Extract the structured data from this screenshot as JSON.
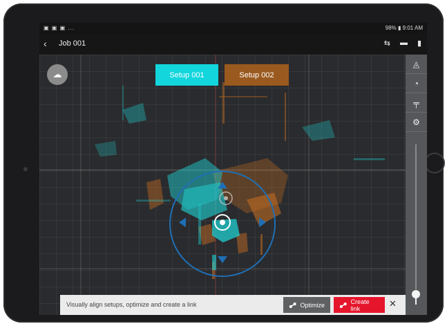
{
  "status_bar": {
    "left_icons": "▣ ▣ ▣ ...",
    "right_text": "98% ▮ 9:01 AM"
  },
  "app_bar": {
    "back_icon": "‹",
    "title": "Job 001",
    "icons": [
      "⇆",
      "▬",
      "▮"
    ]
  },
  "viewport": {
    "layer_icon": "☁",
    "setups": [
      {
        "label": "Setup 001",
        "color": "#12d6dc"
      },
      {
        "label": "Setup 002",
        "color": "#9a5a1f"
      }
    ]
  },
  "sidebar": {
    "buttons": [
      "◬",
      "◔",
      "╤",
      "⚙"
    ]
  },
  "bottom_bar": {
    "hint": "Visually align setups, optimize and create a link",
    "optimize_label": "Optimize",
    "create_link_label": "Create link",
    "close_icon": "✕"
  },
  "colors": {
    "accent_cyan": "#12d6dc",
    "accent_orange": "#d9761f",
    "create_link_red": "#e5162c",
    "ring_blue": "#1f6fb5"
  }
}
